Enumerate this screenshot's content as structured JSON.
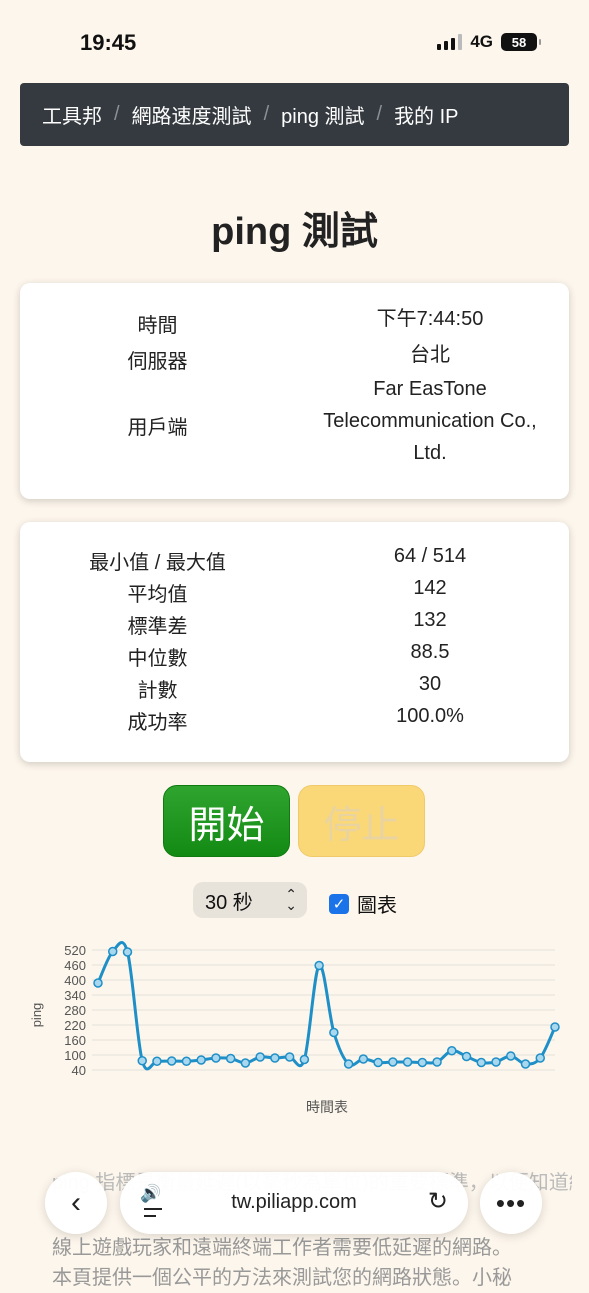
{
  "status_bar": {
    "time": "19:45",
    "network": "4G",
    "battery": "58"
  },
  "breadcrumb": [
    "工具邦",
    "網路速度測試",
    "ping 測試",
    "我的 IP"
  ],
  "page_title": "ping 測試",
  "info": [
    {
      "label": "時間",
      "value": "下午7:44:50"
    },
    {
      "label": "伺服器",
      "value": "台北"
    },
    {
      "label": "用戶端",
      "value_lines": [
        "Far EasTone",
        "Telecommunication Co.,",
        "Ltd."
      ]
    }
  ],
  "stats": [
    {
      "label": "最小值 / 最大值",
      "value": "64 / 514"
    },
    {
      "label": "平均值",
      "value": "142"
    },
    {
      "label": "標準差",
      "value": "132"
    },
    {
      "label": "中位數",
      "value": "88.5"
    },
    {
      "label": "計數",
      "value": "30"
    },
    {
      "label": "成功率",
      "value": "100.0%"
    }
  ],
  "buttons": {
    "start": "開始",
    "stop": "停止"
  },
  "duration_select": {
    "value": "30 秒"
  },
  "chart_checkbox": {
    "label": "圖表",
    "checked": true
  },
  "chart_data": {
    "type": "line",
    "xlabel": "時間表",
    "ylabel": "ping",
    "yticks": [
      40,
      100,
      160,
      220,
      280,
      340,
      400,
      460,
      520
    ],
    "ylim": [
      40,
      520
    ],
    "grid": true,
    "series_color": "#1f8fc7",
    "values": [
      388,
      514,
      512,
      77,
      75,
      76,
      75,
      80,
      88,
      86,
      68,
      92,
      88,
      92,
      82,
      458,
      190,
      64,
      84,
      70,
      72,
      72,
      70,
      72,
      117,
      94,
      70,
      72,
      96,
      64,
      88,
      212
    ]
  },
  "bottom_text": [
    "ping 指標是衡量延遲(以毫秒為單位)的重要標準，以便知道網路的連接速度",
    "線上遊戲玩家和遠端終端工作者需要低延遲的網路。",
    "本頁提供一個公平的方法來測試您的網路狀態。小秘"
  ],
  "browser": {
    "url": "tw.piliapp.com"
  },
  "colors": {
    "breadcrumb_bg": "#343a40",
    "start": "#1a9a1a",
    "stop": "#fbd877",
    "accent": "#1a73e8"
  }
}
